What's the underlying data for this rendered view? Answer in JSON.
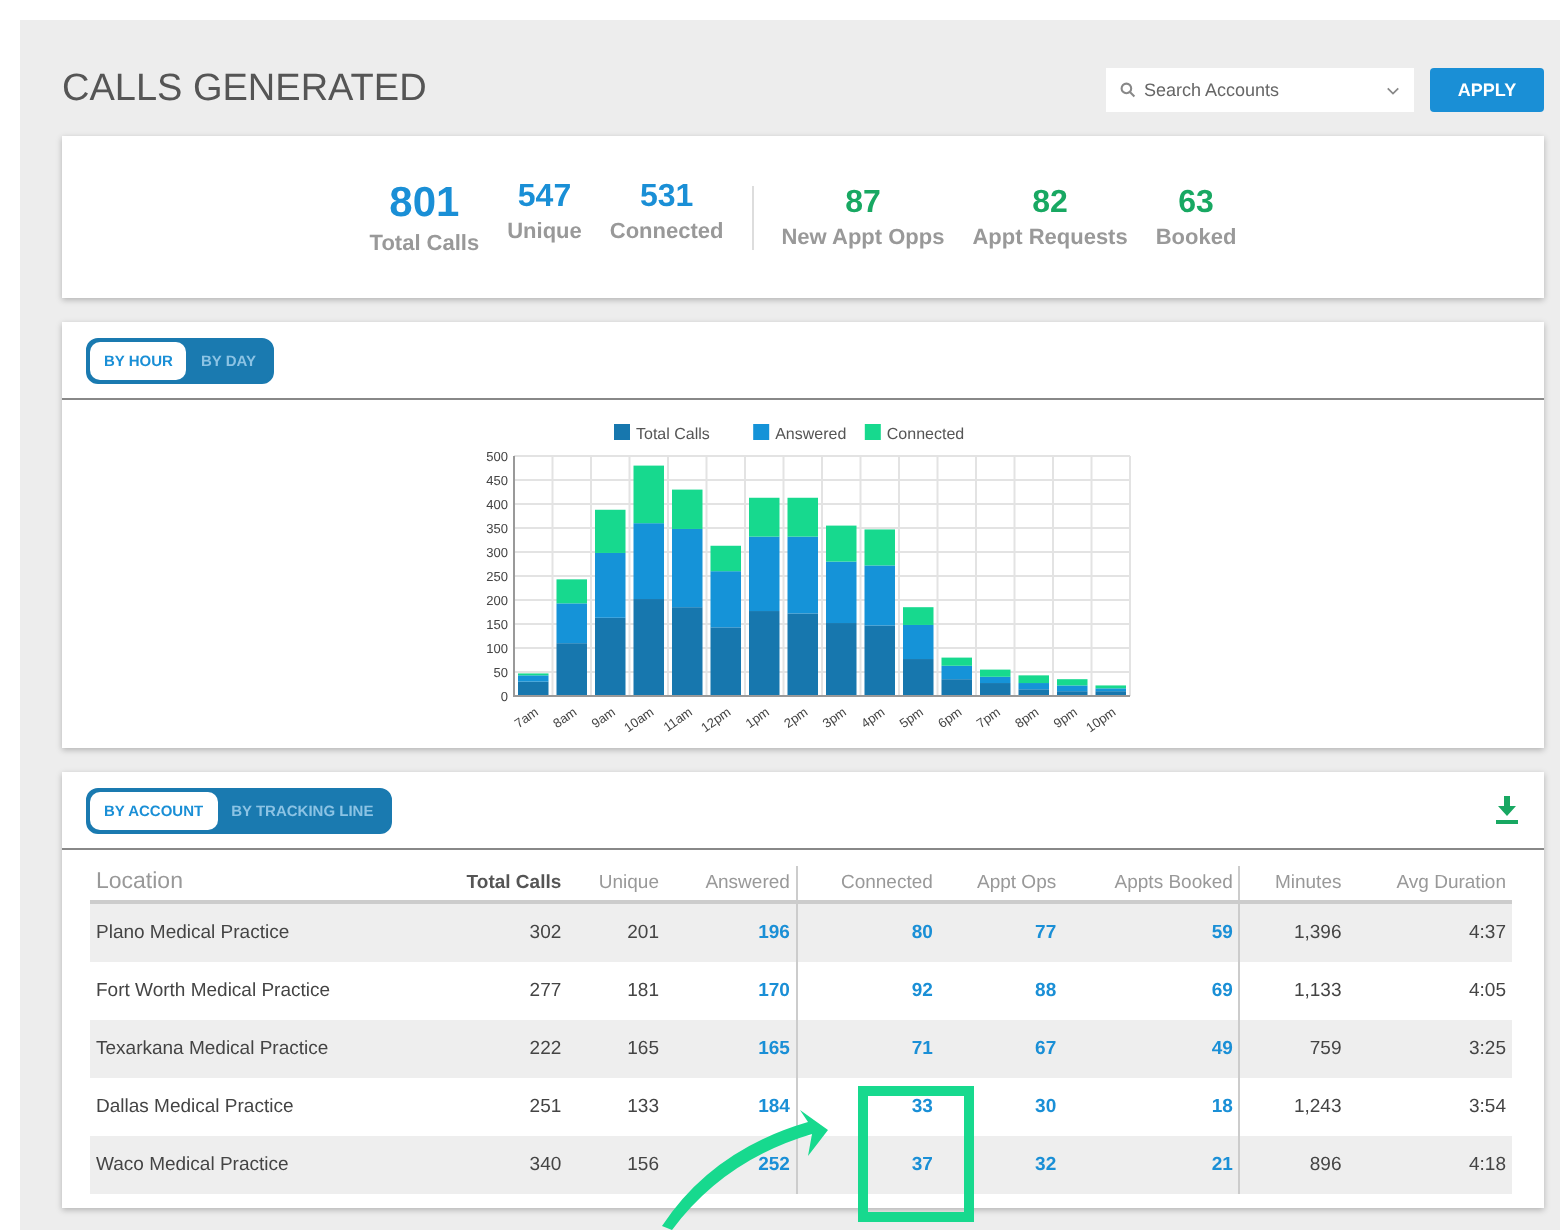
{
  "page_title": "CALLS GENERATED",
  "search": {
    "placeholder": "Search Accounts"
  },
  "apply_button": "APPLY",
  "stat_groups": [
    [
      {
        "value": "801",
        "label": "Total Calls",
        "kind": "main",
        "color": "#1a8fd6"
      },
      {
        "value": "547",
        "label": "Unique",
        "kind": "normal",
        "color": "#1a8fd6"
      },
      {
        "value": "531",
        "label": "Connected",
        "kind": "normal",
        "color": "#1a8fd6"
      }
    ],
    [
      {
        "value": "87",
        "label": "New Appt Opps",
        "kind": "normal",
        "color": "#18a862"
      },
      {
        "value": "82",
        "label": "Appt Requests",
        "kind": "normal",
        "color": "#18a862"
      },
      {
        "value": "63",
        "label": "Booked",
        "kind": "normal",
        "color": "#18a862"
      }
    ]
  ],
  "chart_toggle": [
    {
      "label": "BY HOUR",
      "selected": true
    },
    {
      "label": "BY DAY",
      "selected": false
    }
  ],
  "chart_data": {
    "type": "bar",
    "stacked": true,
    "grid": true,
    "legend": true,
    "categories": [
      "7am",
      "8am",
      "9am",
      "10am",
      "11am",
      "12pm",
      "1pm",
      "2pm",
      "3pm",
      "4pm",
      "5pm",
      "6pm",
      "7pm",
      "8pm",
      "9pm",
      "10pm"
    ],
    "ylim": [
      0,
      500
    ],
    "yticks": [
      0,
      50,
      100,
      150,
      200,
      250,
      300,
      350,
      400,
      450,
      500
    ],
    "series": [
      {
        "name": "Total Calls",
        "color": "#1777ae",
        "values": [
          30,
          110,
          163,
          202,
          185,
          143,
          177,
          172,
          152,
          147,
          77,
          35,
          27,
          14,
          10,
          10
        ]
      },
      {
        "name": "Answered",
        "color": "#1593d8",
        "values": [
          13,
          83,
          135,
          158,
          163,
          117,
          155,
          160,
          128,
          125,
          71,
          28,
          13,
          13,
          12,
          6
        ]
      },
      {
        "name": "Connected",
        "color": "#17d98e",
        "values": [
          4,
          50,
          90,
          120,
          82,
          53,
          81,
          81,
          75,
          75,
          37,
          17,
          15,
          16,
          13,
          6
        ]
      }
    ]
  },
  "table_toggle": [
    {
      "label": "BY ACCOUNT",
      "selected": true
    },
    {
      "label": "BY TRACKING LINE",
      "selected": false
    }
  ],
  "table": {
    "columns": [
      {
        "label": "Location",
        "kind": "text",
        "divider_after": false
      },
      {
        "label": "Total Calls",
        "kind": "number",
        "divider_after": false
      },
      {
        "label": "Unique",
        "kind": "number",
        "divider_after": false
      },
      {
        "label": "Answered",
        "kind": "link",
        "divider_after": true
      },
      {
        "label": "Connected",
        "kind": "link",
        "divider_after": false
      },
      {
        "label": "Appt Ops",
        "kind": "link",
        "divider_after": false
      },
      {
        "label": "Appts Booked",
        "kind": "link",
        "divider_after": true
      },
      {
        "label": "Minutes",
        "kind": "number",
        "divider_after": false
      },
      {
        "label": "Avg Duration",
        "kind": "number",
        "divider_after": false
      }
    ],
    "rows": [
      [
        "Plano Medical Practice",
        "302",
        "201",
        "196",
        "80",
        "77",
        "59",
        "1,396",
        "4:37"
      ],
      [
        "Fort Worth Medical Practice",
        "277",
        "181",
        "170",
        "92",
        "88",
        "69",
        "1,133",
        "4:05"
      ],
      [
        "Texarkana Medical Practice",
        "222",
        "165",
        "165",
        "71",
        "67",
        "49",
        "759",
        "3:25"
      ],
      [
        "Dallas Medical Practice",
        "251",
        "133",
        "184",
        "33",
        "30",
        "18",
        "1,243",
        "3:54"
      ],
      [
        "Waco Medical Practice",
        "340",
        "156",
        "252",
        "37",
        "32",
        "21",
        "896",
        "4:18"
      ]
    ]
  }
}
